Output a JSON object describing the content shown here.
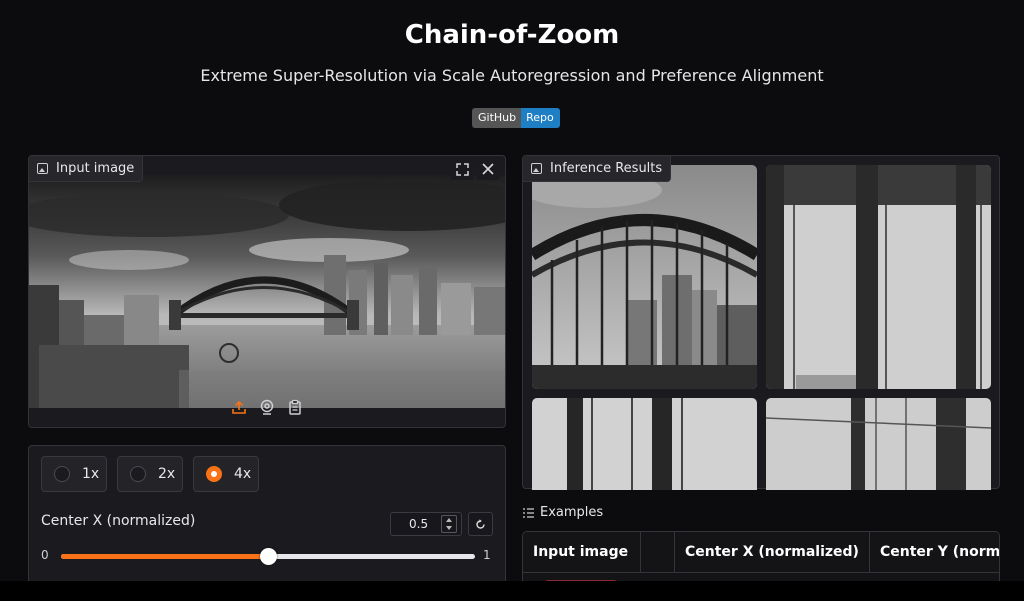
{
  "header": {
    "title": "Chain-of-Zoom",
    "subtitle": "Extreme Super-Resolution via Scale Autoregression and Preference Alignment",
    "badge_left": "GitHub",
    "badge_right": "Repo"
  },
  "input_panel": {
    "label": "Input image",
    "icons": [
      "image-icon",
      "fullscreen-icon",
      "close-icon",
      "upload-icon",
      "webcam-icon",
      "clipboard-icon"
    ]
  },
  "controls": {
    "scale_options": [
      {
        "label": "1x",
        "selected": false
      },
      {
        "label": "2x",
        "selected": false
      },
      {
        "label": "4x",
        "selected": true
      }
    ],
    "center_x": {
      "label": "Center X (normalized)",
      "value": "0.5",
      "min_label": "0",
      "max_label": "1",
      "fraction": 0.5
    }
  },
  "results_panel": {
    "label": "Inference Results"
  },
  "examples": {
    "label": "Examples",
    "columns": [
      "Input image",
      "",
      "Center X (normalized)",
      "Center Y (norm"
    ]
  },
  "colors": {
    "accent": "#f97316",
    "badge_blue": "#1f7fc5",
    "background": "#0c0c0f"
  }
}
